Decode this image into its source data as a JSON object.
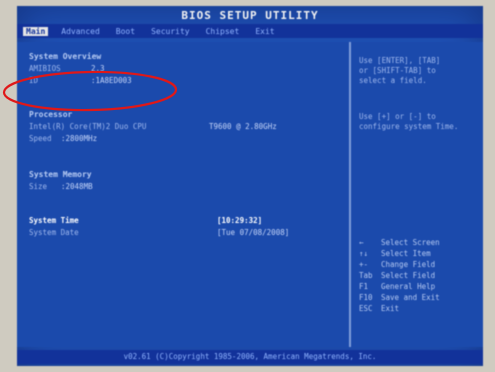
{
  "bios": {
    "title": "BIOS SETUP UTILITY",
    "menu": [
      {
        "label": "Main",
        "active": true
      },
      {
        "label": "Advanced",
        "active": false
      },
      {
        "label": "Boot",
        "active": false
      },
      {
        "label": "Security",
        "active": false
      },
      {
        "label": "Chipset",
        "active": false
      },
      {
        "label": "Exit",
        "active": false
      }
    ],
    "sections": {
      "system_overview": {
        "title": "System Overview",
        "rows": [
          {
            "label": "AMIBIOS",
            "value": "2.3"
          },
          {
            "label": "ID",
            "value": ":1A8ED003"
          }
        ]
      },
      "processor": {
        "title": "Processor",
        "line": "Intel(R) Core(TM)2 Duo CPU",
        "line_value": "T9600  @ 2.80GHz",
        "speed_label": "Speed",
        "speed_value": ":2800MHz"
      },
      "system_memory": {
        "title": "System Memory",
        "size_label": "Size",
        "size_value": ":2048MB"
      },
      "system_time": {
        "label": "System Time",
        "value": "[10:29:32]"
      },
      "system_date": {
        "label": "System Date",
        "value": "[Tue 07/08/2008]"
      }
    },
    "help": {
      "lines_top": [
        "Use [ENTER], [TAB]",
        "or [SHIFT-TAB] to",
        "select a field."
      ],
      "lines_mid": [
        "Use [+] or [-] to",
        "configure system Time."
      ],
      "keys": [
        {
          "key": "←",
          "desc": "Select Screen"
        },
        {
          "key": "↑↓",
          "desc": "Select Item"
        },
        {
          "key": "+-",
          "desc": "Change Field"
        },
        {
          "key": "Tab",
          "desc": "Select Field"
        },
        {
          "key": "F1",
          "desc": "General Help"
        },
        {
          "key": "F10",
          "desc": "Save and Exit"
        },
        {
          "key": "ESC",
          "desc": "Exit"
        }
      ]
    },
    "status": "v02.61 (C)Copyright 1985-2006, American Megatrends, Inc.",
    "colors": {
      "screen_blue": "#1e4fb3",
      "bar_blue": "#12329a",
      "annotation_red": "#e01818"
    }
  }
}
